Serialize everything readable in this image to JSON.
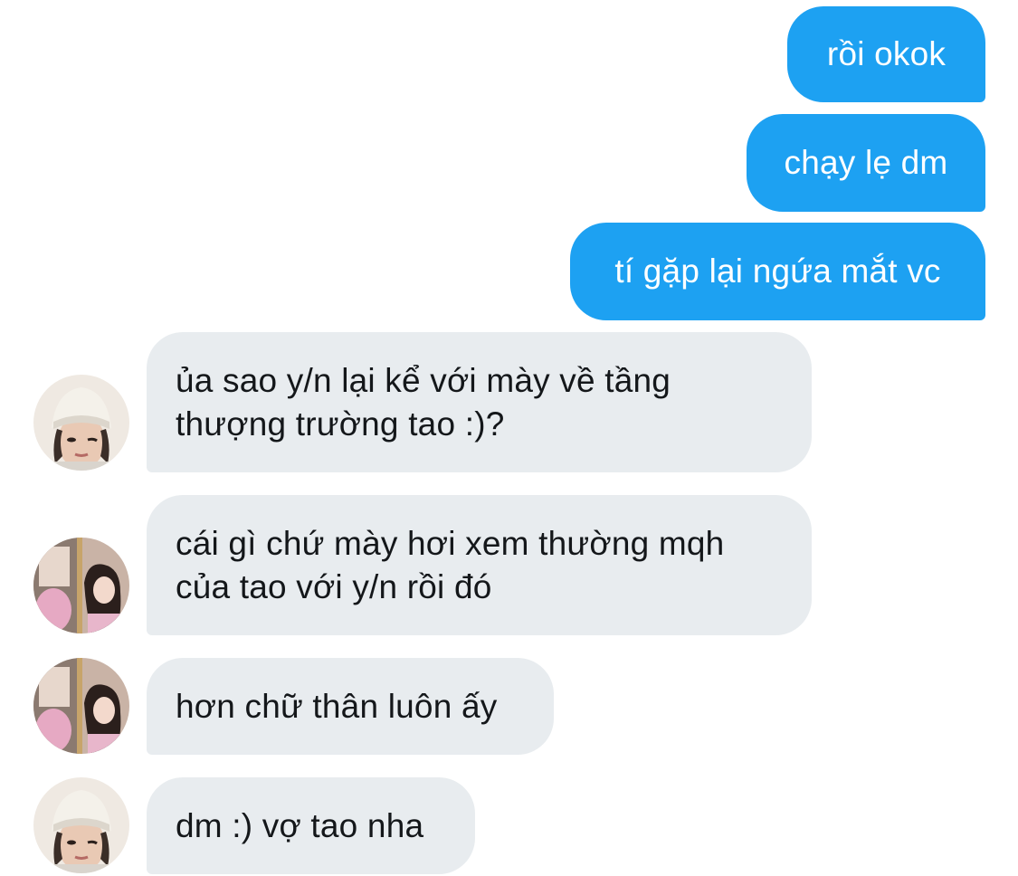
{
  "conversation": {
    "sent": [
      {
        "text": "rồi okok"
      },
      {
        "text": "chạy lẹ dm"
      },
      {
        "text": "tí gặp lại ngứa mắt vc"
      }
    ],
    "received": [
      {
        "text": "ủa sao y/n lại kể với mày về tầng\nthượng trường tao :)?",
        "avatar": "boy-beanie-avatar"
      },
      {
        "text": "cái gì chứ mày hơi xem thường mqh\ncủa tao với y/n rồi đó",
        "avatar": "girl-photo-avatar"
      },
      {
        "text": "hơn chữ thân luôn ấy",
        "avatar": "girl-photo-avatar"
      },
      {
        "text": "dm :) vợ tao nha",
        "avatar": "boy-beanie-avatar"
      }
    ]
  },
  "colors": {
    "sent_bubble": "#1da1f2",
    "received_bubble": "#e8ecef",
    "received_text": "#14171a",
    "background": "#ffffff"
  }
}
